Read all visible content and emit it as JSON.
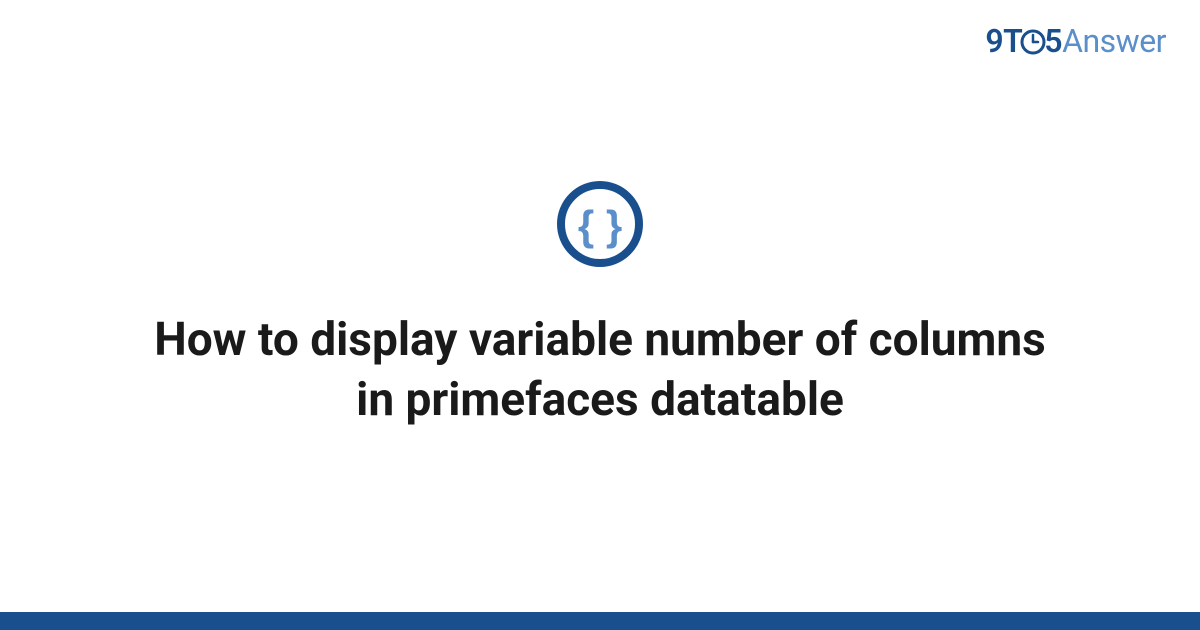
{
  "brand": {
    "text_9": "9",
    "text_t": "T",
    "text_5": "5",
    "text_answer": "Answer"
  },
  "page": {
    "title": "How to display variable number of columns in primefaces datatable"
  },
  "colors": {
    "brand_dark": "#1a4f8e",
    "brand_light": "#5a8fc9",
    "text": "#1a1a1a"
  }
}
